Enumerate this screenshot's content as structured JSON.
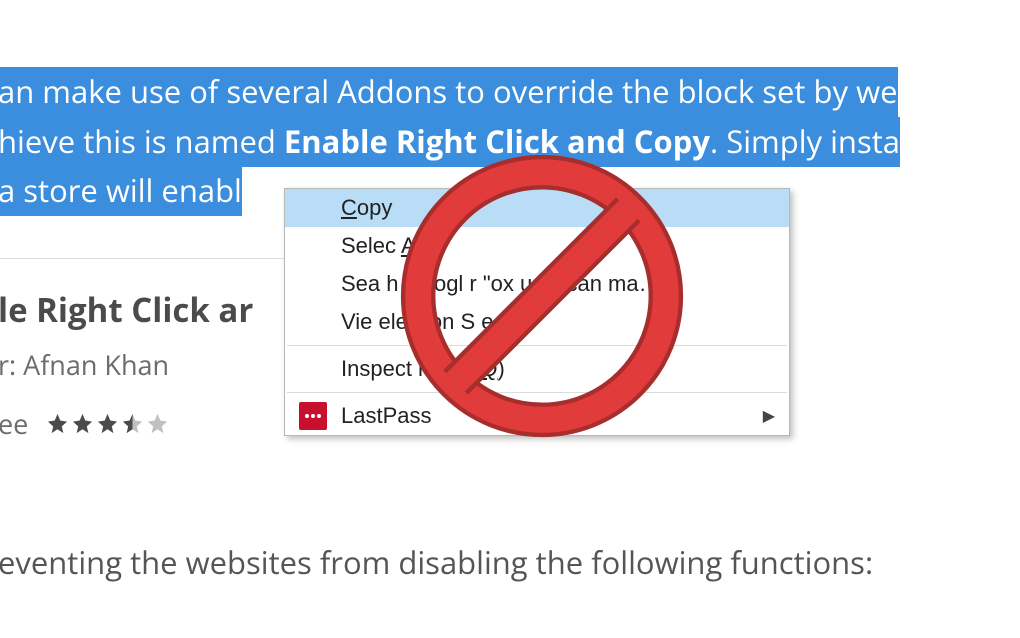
{
  "article": {
    "text_part1": "an make use of several Addons to override the block set by we",
    "text_part2": "hieve this is named ",
    "text_bold": "Enable Right Click and Copy",
    "text_part3": ". Simply insta",
    "text_part4": "a store will enabl"
  },
  "card": {
    "title": "le Right Click ar",
    "author_label": "r: Afnan Khan",
    "price": "ee",
    "rating": 3.5
  },
  "bottom": {
    "text": "eventing the websites from disabling the following functions:"
  },
  "context_menu": {
    "items": [
      {
        "label_pre": "",
        "underline": "C",
        "label_post": "opy",
        "highlighted": true
      },
      {
        "label_pre": "Selec ",
        "underline": "A",
        "label_post": "ll"
      },
      {
        "label_pre": "Sea  h Googl    r \"ox us  s can ma…\"",
        "underline": "",
        "label_post": ""
      },
      {
        "label_pre": "Vie    election S      e",
        "underline": "",
        "label_post": ""
      },
      {
        "label_pre": "Inspect     ment (",
        "underline": "Q",
        "label_post": ")"
      },
      {
        "label_pre": "LastPass",
        "underline": "",
        "label_post": "",
        "icon": "lastpass",
        "submenu": true
      }
    ],
    "copy_label_pre": "",
    "copy_underline": "C",
    "copy_label_post": "opy",
    "select_all_pre": "Selec ",
    "select_all_underline": "A",
    "select_all_post": "ll",
    "search_label": "Sea  h Googl    r \"ox us  s can ma…\"",
    "view_source_label": "Vie    election S      e",
    "inspect_pre": "Inspect     ment (",
    "inspect_underline": "Q",
    "inspect_post": ")",
    "lastpass_label": "LastPass"
  }
}
